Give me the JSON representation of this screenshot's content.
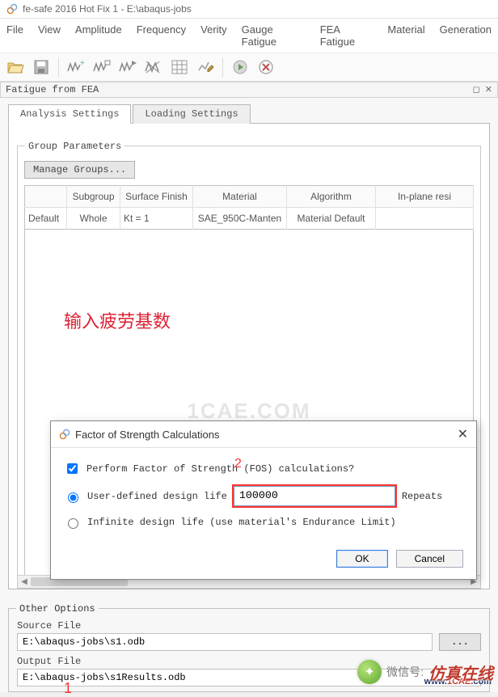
{
  "window": {
    "title": "fe-safe 2016 Hot Fix 1 - E:\\abaqus-jobs"
  },
  "menu": [
    "File",
    "View",
    "Amplitude",
    "Frequency",
    "Verity",
    "Gauge Fatigue",
    "FEA Fatigue",
    "Material",
    "Generation"
  ],
  "panel": {
    "title": "Fatigue from FEA",
    "undock": "◻",
    "close": "✕"
  },
  "tabs": {
    "active": "Analysis Settings",
    "other": "Loading Settings"
  },
  "group_parameters": {
    "legend": "Group Parameters",
    "manage_label": "Manage Groups...",
    "headers": [
      "",
      "Subgroup",
      "Surface Finish",
      "Material",
      "Algorithm",
      "In-plane resi"
    ],
    "row": [
      "Default",
      "Whole",
      "Kt = 1",
      "SAE_950C-Manten",
      "Material Default",
      ""
    ]
  },
  "annotations": {
    "red_text": "输入疲劳基数",
    "watermark": "1CAE.COM",
    "num1": "1",
    "num2": "2"
  },
  "dialog": {
    "title": "Factor of Strength Calculations",
    "perform_label": "Perform Factor of Strength (FOS) calculations?",
    "user_defined_label": "User-defined design life",
    "input_value": "100000",
    "repeats_label": "Repeats",
    "infinite_label": "Infinite design life (use material's Endurance Limit)",
    "ok": "OK",
    "cancel": "Cancel"
  },
  "other_options": {
    "legend": "Other Options",
    "source_label": "Source File",
    "source_value": "E:\\abaqus-jobs\\s1.odb",
    "output_label": "Output File",
    "output_value": "E:\\abaqus-jobs\\s1Results.odb",
    "browse": "..."
  },
  "branding": {
    "wx_label": "微信号:",
    "cn": "仿真在线",
    "url_prefix": "www.",
    "url_main": "1CAE",
    "url_suffix": ".com"
  }
}
